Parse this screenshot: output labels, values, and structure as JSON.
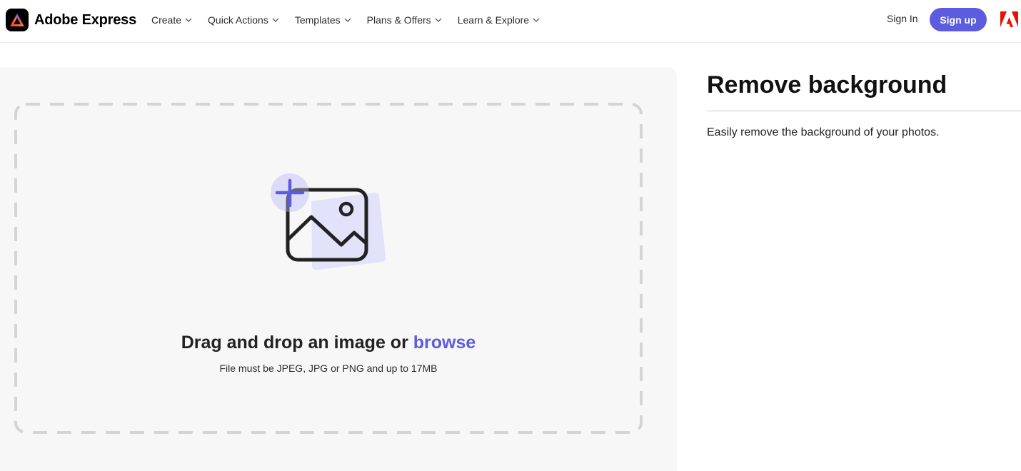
{
  "header": {
    "brand": "Adobe Express",
    "nav": [
      {
        "label": "Create"
      },
      {
        "label": "Quick Actions"
      },
      {
        "label": "Templates"
      },
      {
        "label": "Plans & Offers"
      },
      {
        "label": "Learn & Explore"
      }
    ],
    "sign_in": "Sign In",
    "sign_up": "Sign up"
  },
  "upload": {
    "title_prefix": "Drag and drop an image or",
    "browse": "browse",
    "subtitle": "File must be JPEG, JPG or PNG and up to 17MB"
  },
  "info": {
    "title": "Remove background",
    "description": "Easily remove the background of your photos."
  },
  "colors": {
    "accent": "#5c5ce0",
    "panel_bg": "#f7f7f7",
    "adobe_red": "#eb1000"
  },
  "icons": {
    "brand_logo": "adobe-express-logo-icon",
    "nav_chevron": "chevron-down-icon",
    "adobe": "adobe-logo-icon",
    "upload": "add-image-icon"
  }
}
